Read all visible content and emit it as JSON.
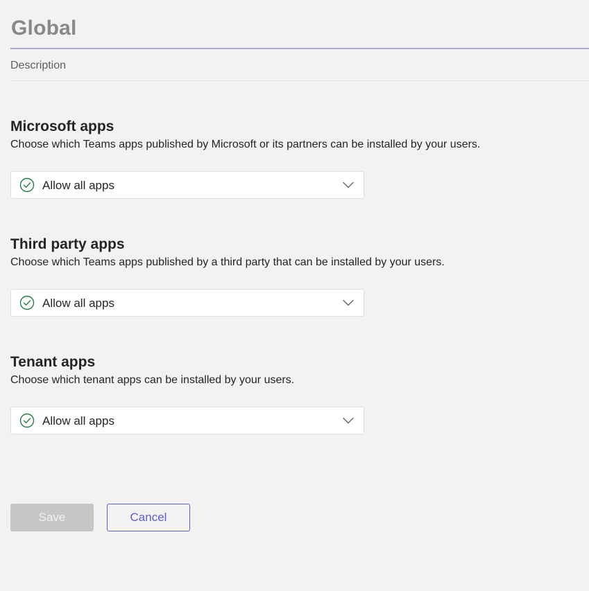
{
  "policy": {
    "name": "Global",
    "description_placeholder": "Description"
  },
  "sections": [
    {
      "title": "Microsoft apps",
      "description": "Choose which Teams apps published by Microsoft or its partners can be installed by your users.",
      "selected": "Allow all apps"
    },
    {
      "title": "Third party apps",
      "description": "Choose which Teams apps published by a third party that can be installed by your users.",
      "selected": "Allow all apps"
    },
    {
      "title": "Tenant apps",
      "description": "Choose which tenant apps can be installed by your users.",
      "selected": "Allow all apps"
    }
  ],
  "actions": {
    "save_label": "Save",
    "cancel_label": "Cancel"
  },
  "colors": {
    "background": "#f3f2f1",
    "accent": "#5b5fc7",
    "check_green": "#237b4b",
    "disabled": "#c8c6c4"
  },
  "icons": {
    "dropdown_status": "check-circle-icon",
    "dropdown_toggle": "chevron-down-icon"
  }
}
